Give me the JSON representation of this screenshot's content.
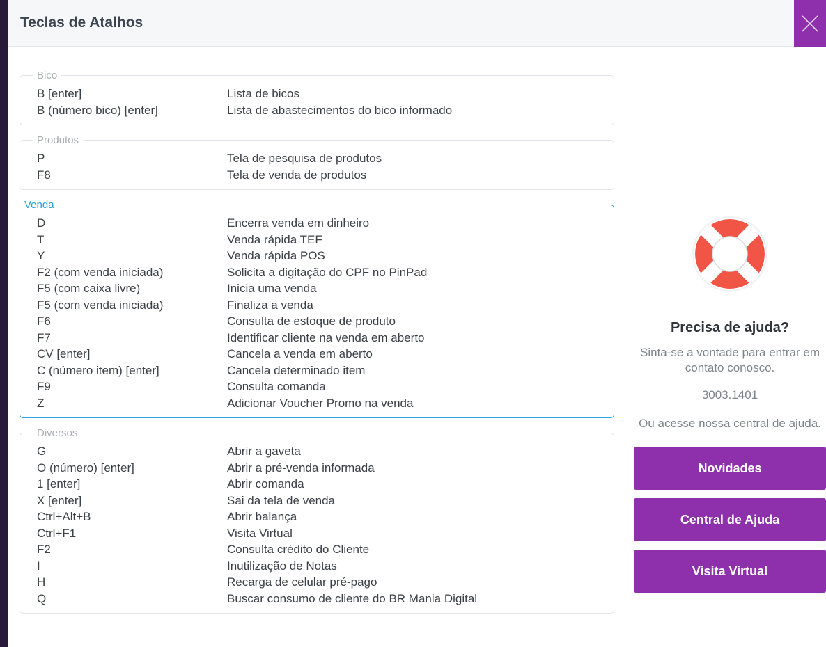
{
  "dialog": {
    "title": "Teclas de Atalhos"
  },
  "sections": [
    {
      "legend": "Bico",
      "active": false,
      "rows": [
        {
          "key": "B [enter]",
          "desc": "Lista de bicos"
        },
        {
          "key": "B (número bico) [enter]",
          "desc": "Lista de abastecimentos do bico informado"
        }
      ]
    },
    {
      "legend": "Produtos",
      "active": false,
      "rows": [
        {
          "key": "P",
          "desc": "Tela de pesquisa de produtos"
        },
        {
          "key": "F8",
          "desc": "Tela de venda de produtos"
        }
      ]
    },
    {
      "legend": "Venda",
      "active": true,
      "rows": [
        {
          "key": "D",
          "desc": "Encerra venda em dinheiro"
        },
        {
          "key": "T",
          "desc": "Venda rápida TEF"
        },
        {
          "key": "Y",
          "desc": "Venda rápida POS"
        },
        {
          "key": "F2 (com venda iniciada)",
          "desc": "Solicita a digitação do CPF no PinPad"
        },
        {
          "key": "F5 (com caixa livre)",
          "desc": "Inicia uma venda"
        },
        {
          "key": "F5 (com venda iniciada)",
          "desc": "Finaliza a venda"
        },
        {
          "key": "F6",
          "desc": "Consulta de estoque de produto"
        },
        {
          "key": "F7",
          "desc": "Identificar cliente na venda em aberto"
        },
        {
          "key": "CV [enter]",
          "desc": "Cancela a venda em aberto"
        },
        {
          "key": "C (número item) [enter]",
          "desc": "Cancela determinado item"
        },
        {
          "key": "F9",
          "desc": "Consulta comanda"
        },
        {
          "key": "Z",
          "desc": "Adicionar Voucher Promo na venda"
        }
      ]
    },
    {
      "legend": "Diversos",
      "active": false,
      "rows": [
        {
          "key": "G",
          "desc": "Abrir a gaveta"
        },
        {
          "key": "O (número) [enter]",
          "desc": "Abrir a pré-venda informada"
        },
        {
          "key": "1 [enter]",
          "desc": "Abrir comanda"
        },
        {
          "key": "X [enter]",
          "desc": "Sai da tela de venda"
        },
        {
          "key": "Ctrl+Alt+B",
          "desc": "Abrir balança"
        },
        {
          "key": "Ctrl+F1",
          "desc": "Visita Virtual"
        },
        {
          "key": "F2",
          "desc": "Consulta crédito do Cliente"
        },
        {
          "key": "I",
          "desc": "Inutilização de Notas"
        },
        {
          "key": "H",
          "desc": "Recarga de celular pré-pago"
        },
        {
          "key": "Q",
          "desc": "Buscar consumo de cliente do BR Mania Digital"
        }
      ]
    }
  ],
  "help": {
    "icon": "lifebuoy-icon",
    "title": "Precisa de ajuda?",
    "text": "Sinta-se a vontade para entrar em contato conosco.",
    "phone": "3003.1401",
    "text2": "Ou acesse nossa central de ajuda.",
    "buttons": [
      {
        "label": "Novidades",
        "name": "novidades-button"
      },
      {
        "label": "Central de Ajuda",
        "name": "central-de-ajuda-button"
      },
      {
        "label": "Visita Virtual",
        "name": "visita-virtual-button"
      }
    ]
  },
  "colors": {
    "accent": "#8e2fab",
    "active_border": "#2aa6e0",
    "text": "#3c4148",
    "muted": "#a9aeb4"
  }
}
